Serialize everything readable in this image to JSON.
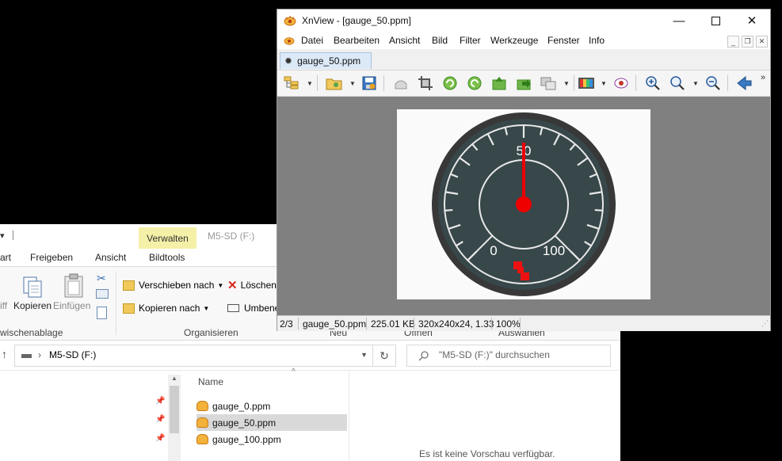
{
  "explorer": {
    "verwalten": "Verwalten",
    "drive_title": "M5-SD (F:)",
    "tabs": [
      "art",
      "Freigeben",
      "Ansicht",
      "Bildtools"
    ],
    "ribbon": {
      "copy_path_partial": "iff",
      "kopieren": "Kopieren",
      "einfuegen": "Einfügen",
      "verschieben": "Verschieben nach",
      "kopieren_nach": "Kopieren nach",
      "loeschen": "Löschen",
      "umbenennen": "Umbene",
      "group_clipboard": "wischenablage",
      "group_organize": "Organisieren",
      "group_neu": "Neu",
      "group_oeffnen": "Öffnen",
      "group_auswaehlen": "Auswählen"
    },
    "address": {
      "path": "M5-SD (F:)",
      "search_placeholder": "\"M5-SD (F:)\" durchsuchen"
    },
    "columns": {
      "name": "Name"
    },
    "files": [
      "gauge_0.ppm",
      "gauge_50.ppm",
      "gauge_100.ppm"
    ],
    "selected_index": 1,
    "preview_text": "Es ist keine Vorschau verfügbar."
  },
  "xnview": {
    "title": "XnView - [gauge_50.ppm]",
    "menu": [
      "Datei",
      "Bearbeiten",
      "Ansicht",
      "Bild",
      "Filter",
      "Werkzeuge",
      "Fenster",
      "Info"
    ],
    "tab_label": "gauge_50.ppm",
    "status": {
      "index": "2/3",
      "filename": "gauge_50.ppm",
      "size": "225.01 KB",
      "dims": "320x240x24, 1.33",
      "zoom": "100%"
    },
    "gauge": {
      "label_0": "0",
      "label_50": "50",
      "label_100": "100",
      "value": 50,
      "max": 100,
      "needle_color": "#ee0000",
      "dial_color": "#37474a"
    }
  },
  "colors": {
    "accent_tab": "#dce9f7",
    "verwalten_bg": "#f5f0a8",
    "viewer_bg": "#808080"
  }
}
